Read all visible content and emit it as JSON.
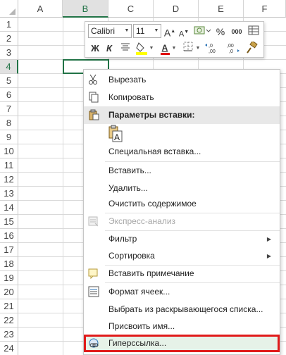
{
  "sheet": {
    "columns": [
      "A",
      "B",
      "C",
      "D",
      "E",
      "F"
    ],
    "selected_column": "B",
    "rows": [
      "1",
      "2",
      "3",
      "4",
      "5",
      "6",
      "7",
      "8",
      "9",
      "10",
      "11",
      "12",
      "13",
      "14",
      "15",
      "16",
      "17",
      "18",
      "19",
      "20",
      "21",
      "22",
      "23",
      "24"
    ],
    "selected_row": "4"
  },
  "mini_toolbar": {
    "font_name": "Calibri",
    "font_size": "11",
    "bold": "Ж",
    "italic": "К",
    "increase_font": "A",
    "decrease_font": "A",
    "percent": "%",
    "thousands": "000",
    "inc_decimal": "←,0 ,00",
    "dec_decimal": ",00 →,0",
    "font_color_letter": "A",
    "colors": {
      "fill": "#ffff00",
      "font": "#e00000"
    }
  },
  "context_menu": {
    "cut": "Вырезать",
    "copy": "Копировать",
    "paste_options": "Параметры вставки:",
    "paste_special": "Специальная вставка...",
    "insert": "Вставить...",
    "delete": "Удалить...",
    "clear_contents": "Очистить содержимое",
    "quick_analysis": "Экспресс-анализ",
    "filter": "Фильтр",
    "sort": "Сортировка",
    "insert_comment": "Вставить примечание",
    "format_cells": "Формат ячеек...",
    "pick_list": "Выбрать из раскрывающегося списка...",
    "define_name": "Присвоить имя...",
    "hyperlink": "Гиперссылка...",
    "highlight_color": "#e01a1a"
  }
}
